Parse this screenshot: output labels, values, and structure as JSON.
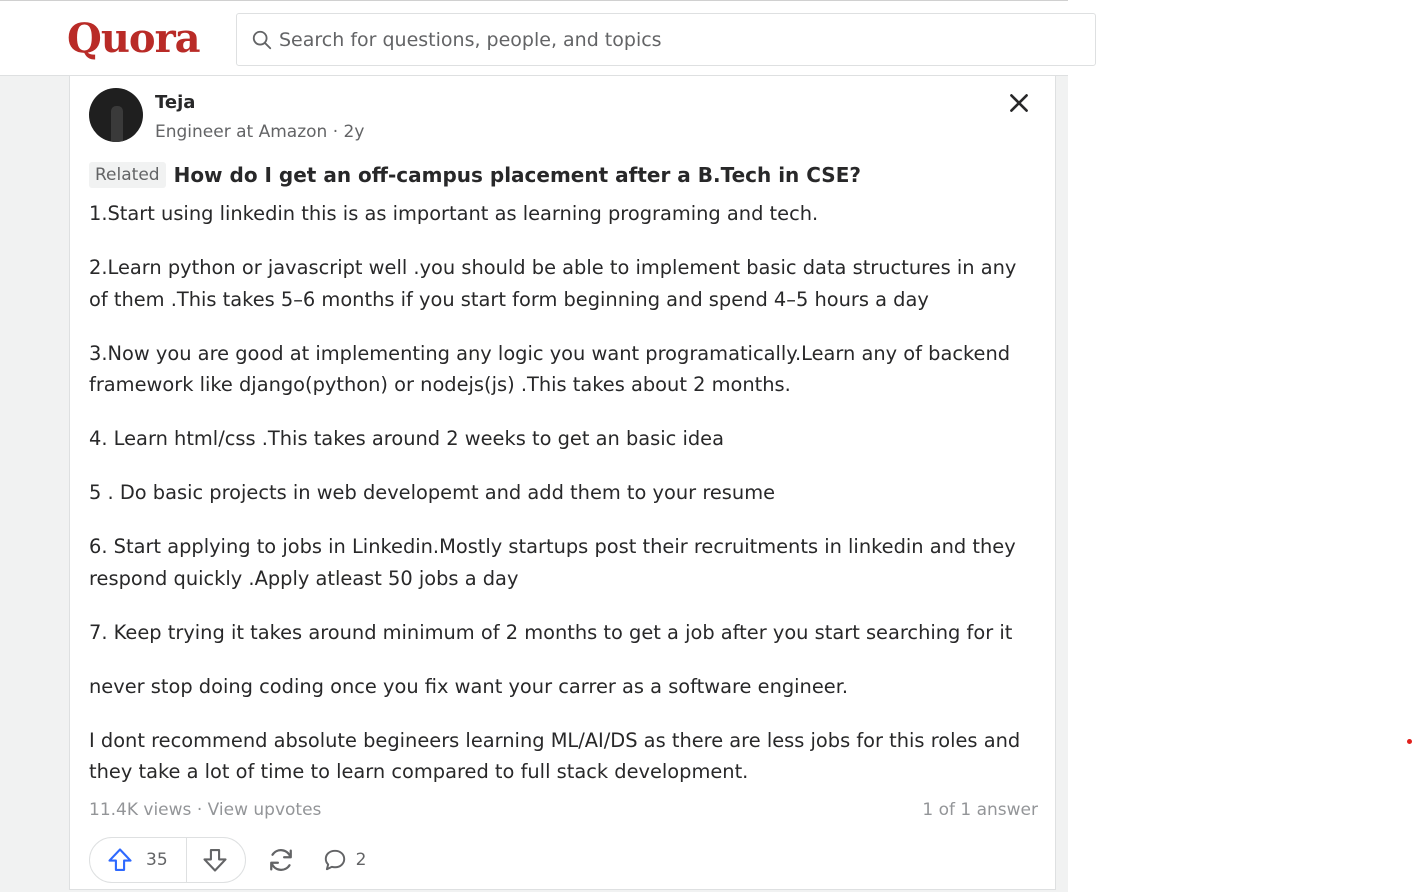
{
  "header": {
    "logo": "Quora",
    "search_placeholder": "Search for questions, people, and topics",
    "search_icon": "search-icon"
  },
  "answer": {
    "author": {
      "name": "Teja",
      "meta": "Engineer at Amazon · 2y",
      "avatar_icon": "avatar"
    },
    "close_icon": "close-icon",
    "related_tag": "Related",
    "question": "How do I get an off-campus placement after a B.Tech in CSE?",
    "paragraphs": [
      "1.Start using linkedin this is as important as learning programing and tech.",
      "2.Learn python or javascript well .you should be able to implement basic data structures in any of them .This takes 5–6 months if you start form beginning and spend 4–5 hours a day",
      "3.Now you are good at implementing any logic you want programatically.Learn any of backend framework like django(python) or nodejs(js) .This takes about 2 months.",
      "4. Learn html/css .This takes around 2 weeks to get an basic idea",
      "5 . Do basic projects in web developemt and add them to your resume",
      "6. Start applying to jobs in Linkedin.Mostly startups post their recruitments in linkedin and they respond quickly .Apply atleast 50 jobs a day",
      "7. Keep trying it takes around minimum of 2 months to get a job after you start searching for it",
      "never stop doing coding once you fix want your carrer as a software engineer.",
      "I dont recommend absolute begineers learning ML/AI/DS as there are less jobs for this roles and they take a lot of time to learn compared to full stack development."
    ],
    "views": "11.4K views",
    "view_upvotes": "View upvotes",
    "answer_position": "1 of 1 answer",
    "upvotes": "35",
    "comments": "2",
    "icons": {
      "upvote": "upvote-arrow-icon",
      "downvote": "downvote-arrow-icon",
      "share": "share-icon",
      "comment": "comment-icon"
    }
  },
  "colors": {
    "brand": "#b92b27",
    "upvote": "#2e69ff",
    "text": "#282829",
    "muted": "#636466",
    "background": "#f1f2f2"
  }
}
